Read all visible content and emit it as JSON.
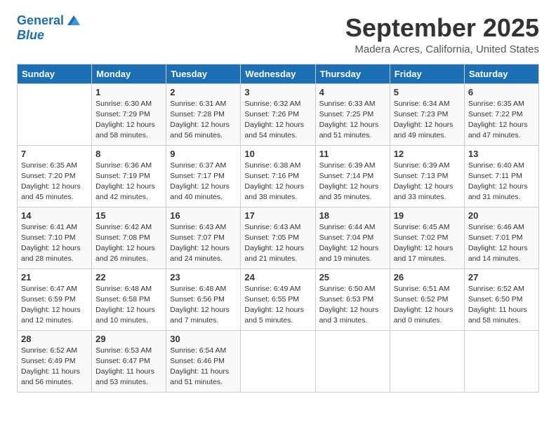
{
  "header": {
    "logo_line1": "General",
    "logo_line2": "Blue",
    "month": "September 2025",
    "location": "Madera Acres, California, United States"
  },
  "days_of_week": [
    "Sunday",
    "Monday",
    "Tuesday",
    "Wednesday",
    "Thursday",
    "Friday",
    "Saturday"
  ],
  "weeks": [
    [
      {
        "num": "",
        "detail": ""
      },
      {
        "num": "1",
        "detail": "Sunrise: 6:30 AM\nSunset: 7:29 PM\nDaylight: 12 hours\nand 58 minutes."
      },
      {
        "num": "2",
        "detail": "Sunrise: 6:31 AM\nSunset: 7:28 PM\nDaylight: 12 hours\nand 56 minutes."
      },
      {
        "num": "3",
        "detail": "Sunrise: 6:32 AM\nSunset: 7:26 PM\nDaylight: 12 hours\nand 54 minutes."
      },
      {
        "num": "4",
        "detail": "Sunrise: 6:33 AM\nSunset: 7:25 PM\nDaylight: 12 hours\nand 51 minutes."
      },
      {
        "num": "5",
        "detail": "Sunrise: 6:34 AM\nSunset: 7:23 PM\nDaylight: 12 hours\nand 49 minutes."
      },
      {
        "num": "6",
        "detail": "Sunrise: 6:35 AM\nSunset: 7:22 PM\nDaylight: 12 hours\nand 47 minutes."
      }
    ],
    [
      {
        "num": "7",
        "detail": "Sunrise: 6:35 AM\nSunset: 7:20 PM\nDaylight: 12 hours\nand 45 minutes."
      },
      {
        "num": "8",
        "detail": "Sunrise: 6:36 AM\nSunset: 7:19 PM\nDaylight: 12 hours\nand 42 minutes."
      },
      {
        "num": "9",
        "detail": "Sunrise: 6:37 AM\nSunset: 7:17 PM\nDaylight: 12 hours\nand 40 minutes."
      },
      {
        "num": "10",
        "detail": "Sunrise: 6:38 AM\nSunset: 7:16 PM\nDaylight: 12 hours\nand 38 minutes."
      },
      {
        "num": "11",
        "detail": "Sunrise: 6:39 AM\nSunset: 7:14 PM\nDaylight: 12 hours\nand 35 minutes."
      },
      {
        "num": "12",
        "detail": "Sunrise: 6:39 AM\nSunset: 7:13 PM\nDaylight: 12 hours\nand 33 minutes."
      },
      {
        "num": "13",
        "detail": "Sunrise: 6:40 AM\nSunset: 7:11 PM\nDaylight: 12 hours\nand 31 minutes."
      }
    ],
    [
      {
        "num": "14",
        "detail": "Sunrise: 6:41 AM\nSunset: 7:10 PM\nDaylight: 12 hours\nand 28 minutes."
      },
      {
        "num": "15",
        "detail": "Sunrise: 6:42 AM\nSunset: 7:08 PM\nDaylight: 12 hours\nand 26 minutes."
      },
      {
        "num": "16",
        "detail": "Sunrise: 6:43 AM\nSunset: 7:07 PM\nDaylight: 12 hours\nand 24 minutes."
      },
      {
        "num": "17",
        "detail": "Sunrise: 6:43 AM\nSunset: 7:05 PM\nDaylight: 12 hours\nand 21 minutes."
      },
      {
        "num": "18",
        "detail": "Sunrise: 6:44 AM\nSunset: 7:04 PM\nDaylight: 12 hours\nand 19 minutes."
      },
      {
        "num": "19",
        "detail": "Sunrise: 6:45 AM\nSunset: 7:02 PM\nDaylight: 12 hours\nand 17 minutes."
      },
      {
        "num": "20",
        "detail": "Sunrise: 6:46 AM\nSunset: 7:01 PM\nDaylight: 12 hours\nand 14 minutes."
      }
    ],
    [
      {
        "num": "21",
        "detail": "Sunrise: 6:47 AM\nSunset: 6:59 PM\nDaylight: 12 hours\nand 12 minutes."
      },
      {
        "num": "22",
        "detail": "Sunrise: 6:48 AM\nSunset: 6:58 PM\nDaylight: 12 hours\nand 10 minutes."
      },
      {
        "num": "23",
        "detail": "Sunrise: 6:48 AM\nSunset: 6:56 PM\nDaylight: 12 hours\nand 7 minutes."
      },
      {
        "num": "24",
        "detail": "Sunrise: 6:49 AM\nSunset: 6:55 PM\nDaylight: 12 hours\nand 5 minutes."
      },
      {
        "num": "25",
        "detail": "Sunrise: 6:50 AM\nSunset: 6:53 PM\nDaylight: 12 hours\nand 3 minutes."
      },
      {
        "num": "26",
        "detail": "Sunrise: 6:51 AM\nSunset: 6:52 PM\nDaylight: 12 hours\nand 0 minutes."
      },
      {
        "num": "27",
        "detail": "Sunrise: 6:52 AM\nSunset: 6:50 PM\nDaylight: 11 hours\nand 58 minutes."
      }
    ],
    [
      {
        "num": "28",
        "detail": "Sunrise: 6:52 AM\nSunset: 6:49 PM\nDaylight: 11 hours\nand 56 minutes."
      },
      {
        "num": "29",
        "detail": "Sunrise: 6:53 AM\nSunset: 6:47 PM\nDaylight: 11 hours\nand 53 minutes."
      },
      {
        "num": "30",
        "detail": "Sunrise: 6:54 AM\nSunset: 6:46 PM\nDaylight: 11 hours\nand 51 minutes."
      },
      {
        "num": "",
        "detail": ""
      },
      {
        "num": "",
        "detail": ""
      },
      {
        "num": "",
        "detail": ""
      },
      {
        "num": "",
        "detail": ""
      }
    ]
  ]
}
